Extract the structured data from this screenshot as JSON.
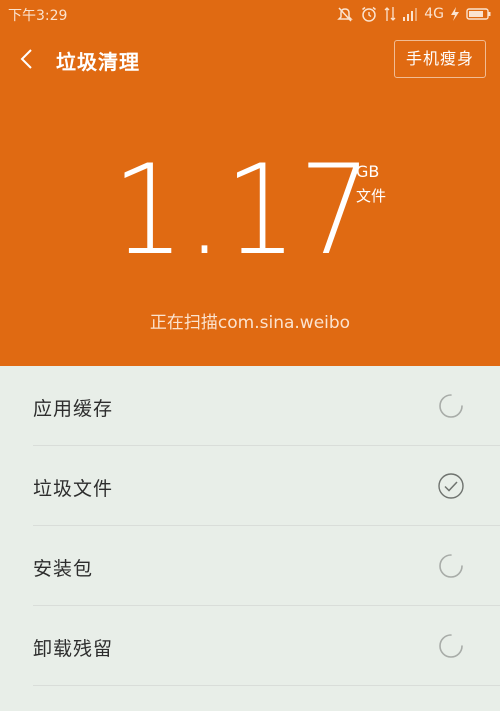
{
  "status_bar": {
    "time": "下午3:29",
    "network": "4G",
    "icons": [
      "mute-icon",
      "alarm-icon",
      "data-arrows-icon",
      "signal-icon",
      "charging-icon",
      "battery-icon"
    ]
  },
  "header": {
    "title": "垃圾清理",
    "slim_button": "手机瘦身",
    "back_icon": "chevron-left-icon"
  },
  "scan": {
    "size_value": "1.17",
    "size_unit": "GB",
    "size_sub": "文件",
    "status_text": "正在扫描com.sina.weibo"
  },
  "items": [
    {
      "label": "应用缓存",
      "state": "scanning",
      "icon": "spinner-icon"
    },
    {
      "label": "垃圾文件",
      "state": "done",
      "icon": "check-circle-icon"
    },
    {
      "label": "安装包",
      "state": "scanning",
      "icon": "spinner-icon"
    },
    {
      "label": "卸载残留",
      "state": "scanning",
      "icon": "spinner-icon"
    }
  ],
  "colors": {
    "header_bg": "#e06a12",
    "list_bg": "#e8eee8",
    "text": "#2d2d2d",
    "icon_gray": "#a8aca8"
  }
}
